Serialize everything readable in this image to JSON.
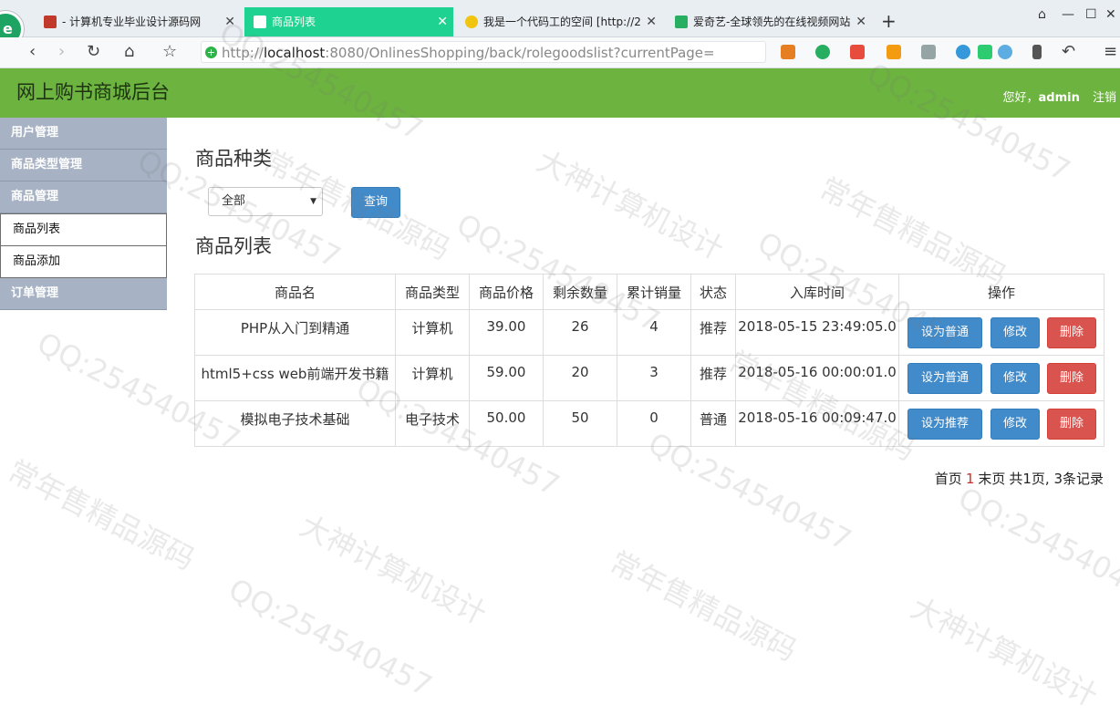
{
  "browser": {
    "tabs": [
      {
        "label": "- 计算机专业毕业设计源码网",
        "active": false
      },
      {
        "label": "商品列表",
        "active": true
      },
      {
        "label": "我是一个代码工的空间 [http://2",
        "active": false
      },
      {
        "label": "爱奇艺-全球领先的在线视频网站",
        "active": false
      }
    ],
    "url_prefix": "http://",
    "url_host": "localhost",
    "url_rest": ":8080/OnlinesShopping/back/rolegoodslist?currentPage="
  },
  "header": {
    "title": "网上购书商城后台",
    "greeting": "您好，",
    "username": "admin",
    "logout": "注销"
  },
  "sidebar": {
    "groups": [
      {
        "label": "用户管理"
      },
      {
        "label": "商品类型管理"
      },
      {
        "label": "商品管理",
        "children": [
          {
            "label": "商品列表"
          },
          {
            "label": "商品添加"
          }
        ]
      },
      {
        "label": "订单管理"
      }
    ]
  },
  "filter": {
    "heading": "商品种类",
    "selected": "全部",
    "query_button": "查询"
  },
  "list": {
    "heading": "商品列表",
    "columns": [
      "商品名",
      "商品类型",
      "商品价格",
      "剩余数量",
      "累计销量",
      "状态",
      "入库时间",
      "操作"
    ],
    "rows": [
      {
        "name": "PHP从入门到精通",
        "type": "计算机",
        "price": "39.00",
        "stock": "26",
        "sales": "4",
        "status": "推荐",
        "time": "2018-05-15 23:49:05.0",
        "toggle": "设为普通",
        "edit": "修改",
        "delete": "删除"
      },
      {
        "name": "html5+css web前端开发书籍",
        "type": "计算机",
        "price": "59.00",
        "stock": "20",
        "sales": "3",
        "status": "推荐",
        "time": "2018-05-16 00:00:01.0",
        "toggle": "设为普通",
        "edit": "修改",
        "delete": "删除"
      },
      {
        "name": "模拟电子技术基础",
        "type": "电子技术",
        "price": "50.00",
        "stock": "50",
        "sales": "0",
        "status": "普通",
        "time": "2018-05-16 00:09:47.0",
        "toggle": "设为推荐",
        "edit": "修改",
        "delete": "删除"
      }
    ]
  },
  "pager": {
    "first": "首页",
    "current": "1",
    "last": "末页",
    "summary": "共1页, 3条记录"
  },
  "watermarks": [
    "QQ:254540457",
    "常年售精品源码",
    "大神计算机设计"
  ],
  "colors": {
    "header": "#6db33f",
    "sidebar": "#a7b2c4",
    "active_tab": "#1ed391",
    "primary": "#428bca",
    "danger": "#d9534f"
  }
}
